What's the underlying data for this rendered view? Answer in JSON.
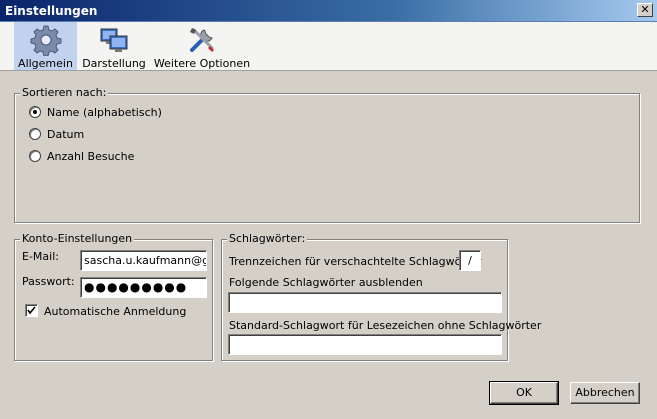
{
  "window": {
    "title": "Einstellungen",
    "close_glyph": "✕"
  },
  "toolbar": {
    "tabs": [
      {
        "label": "Allgemein",
        "icon": "gear-icon",
        "active": true
      },
      {
        "label": "Darstellung",
        "icon": "monitors-icon",
        "active": false
      },
      {
        "label": "Weitere Optionen",
        "icon": "tools-icon",
        "active": false
      }
    ]
  },
  "sort": {
    "legend": "Sortieren nach:",
    "options": [
      {
        "label": "Name (alphabetisch)",
        "checked": true
      },
      {
        "label": "Datum",
        "checked": false
      },
      {
        "label": "Anzahl Besuche",
        "checked": false
      }
    ]
  },
  "account": {
    "legend": "Konto-Einstellungen",
    "email_label": "E-Mail:",
    "email_value": "sascha.u.kaufmann@go",
    "password_label": "Passwort:",
    "password_value": "●●●●●●●●●",
    "auto_login_label": "Automatische Anmeldung",
    "auto_login_checked": true
  },
  "tags": {
    "legend": "Schlagwörter:",
    "separator_label": "Trennzeichen für verschachtelte Schlagwörter",
    "separator_value": "/",
    "hide_label": "Folgende Schlagwörter ausblenden",
    "hide_value": "",
    "default_label": "Standard-Schlagwort für Lesezeichen ohne Schlagwörter",
    "default_value": ""
  },
  "buttons": {
    "ok": "OK",
    "cancel": "Abbrechen"
  }
}
